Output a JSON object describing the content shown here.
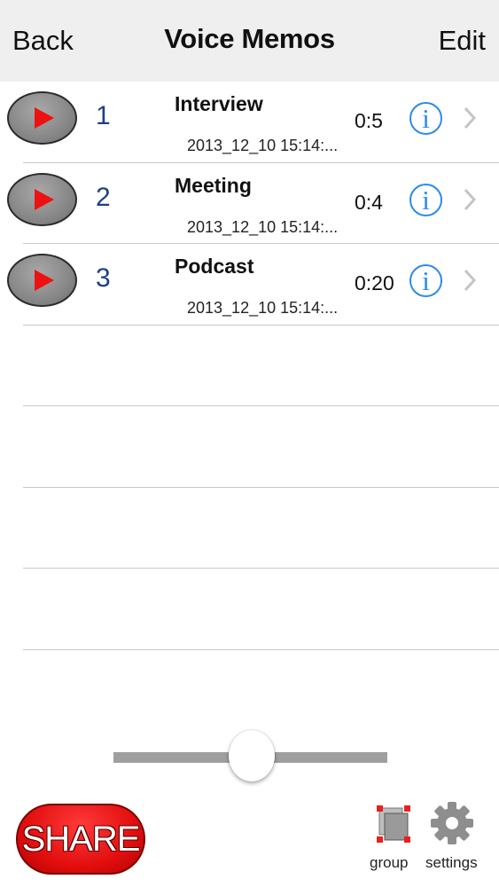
{
  "nav": {
    "back_label": "Back",
    "title": "Voice Memos",
    "edit_label": "Edit"
  },
  "memos": [
    {
      "number": "1",
      "title": "Interview",
      "date": "2013_12_10 15:14:...",
      "duration": "0:5"
    },
    {
      "number": "2",
      "title": "Meeting",
      "date": "2013_12_10 15:14:...",
      "duration": "0:4"
    },
    {
      "number": "3",
      "title": "Podcast",
      "date": "2013_12_10 15:14:...",
      "duration": "0:20"
    }
  ],
  "icons": {
    "play": "play-icon",
    "info": "info-icon",
    "chevron": "chevron-right-icon",
    "group": "group-icon",
    "settings": "gear-icon"
  },
  "toolbar": {
    "share_label": "SHARE",
    "group_label": "group",
    "settings_label": "settings"
  },
  "colors": {
    "accent": "#2d8ae8",
    "share": "#e30f0f",
    "number": "#1c3f86",
    "navbar": "#efefef"
  }
}
